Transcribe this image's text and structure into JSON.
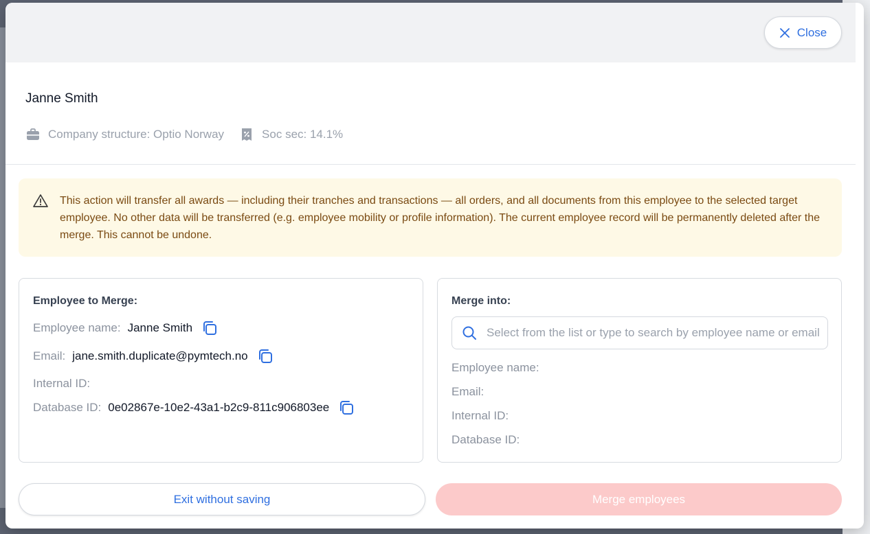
{
  "header": {
    "close_label": "Close"
  },
  "employee": {
    "name": "Janne Smith",
    "company_structure": "Company structure: Optio Norway",
    "soc_sec": "Soc sec: 14.1%"
  },
  "warning": {
    "text": "This action will transfer all awards — including their tranches and transactions — all orders, and all documents from this employee to the selected target employee. No other data will be transferred (e.g. employee mobility or profile information). The current employee record will be permanently deleted after the merge. This cannot be undone."
  },
  "merge_from": {
    "title": "Employee to Merge:",
    "name_label": "Employee name:",
    "name_value": "Janne Smith",
    "email_label": "Email:",
    "email_value": "jane.smith.duplicate@pymtech.no",
    "internal_id_label": "Internal ID:",
    "database_id_label": "Database ID:",
    "database_id_value": "0e02867e-10e2-43a1-b2c9-811c906803ee"
  },
  "merge_into": {
    "title": "Merge into:",
    "search_placeholder": "Select from the list or type to search by employee name or email",
    "name_label": "Employee name:",
    "email_label": "Email:",
    "internal_id_label": "Internal ID:",
    "database_id_label": "Database ID:"
  },
  "footer": {
    "exit_label": "Exit without saving",
    "merge_label": "Merge employees"
  },
  "colors": {
    "accent": "#2f6fe0",
    "warning_bg": "#fef9e6",
    "merge_disabled": "#fccaca"
  }
}
